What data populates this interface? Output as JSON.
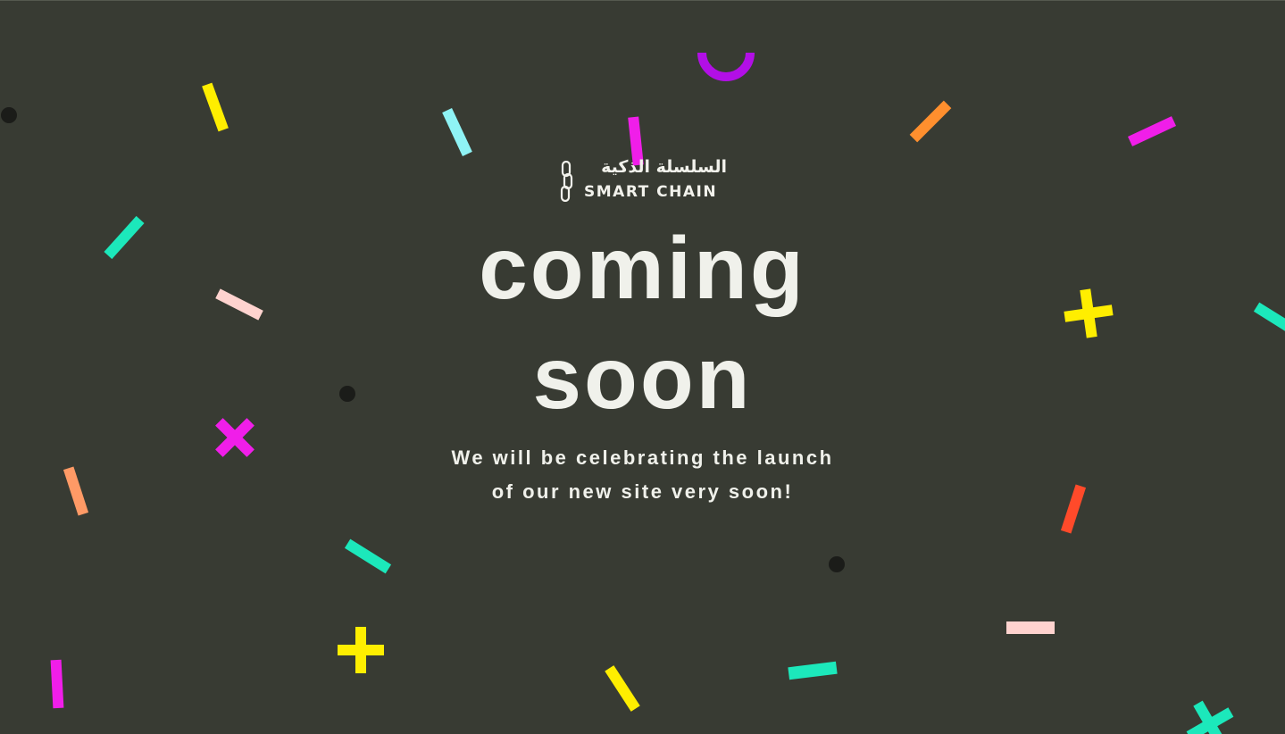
{
  "page": {
    "background": "#383b33",
    "text_color": "#f0f1eb"
  },
  "logo": {
    "arabic_text": "السلسلة الذكية",
    "english_text": "SMART CHAIN",
    "icon": "chain-link-icon"
  },
  "headline": {
    "line1": "coming",
    "line2": "soon"
  },
  "tagline": {
    "line1": "We will be celebrating the launch",
    "line2": "of our new site very soon!"
  },
  "confetti_colors": {
    "yellow": "#ffee00",
    "cyan": "#8ff3f5",
    "magenta": "#f01ee9",
    "orange": "#ff8f2e",
    "purple": "#b20fe6",
    "teal": "#1ce8bb",
    "pink": "#ffd3cf",
    "salmon": "#ff9a66",
    "red": "#ff4a2a",
    "dark": "#1b1c19"
  }
}
